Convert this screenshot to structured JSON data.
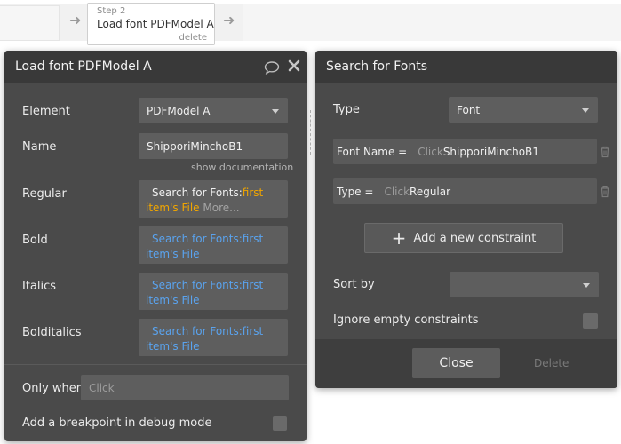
{
  "workflow": {
    "step_no": "Step 2",
    "step_title": "Load font PDFModel A",
    "step_delete": "delete"
  },
  "left_panel": {
    "title": "Load font PDFModel A",
    "element_label": "Element",
    "element_value": "PDFModel A",
    "name_label": "Name",
    "name_value": "ShipporiMinchoB1",
    "show_documentation": "show documentation",
    "regular_label": "Regular",
    "regular_expr_source": "Search for Fonts:",
    "regular_expr_op1": "first",
    "regular_expr_op2": "item's File",
    "regular_expr_more": "More...",
    "bold_label": "Bold",
    "bold_expr_line1": "Search for Fonts:first",
    "bold_expr_line2": "item's File",
    "italics_label": "Italics",
    "italics_expr_line1": "Search for Fonts:first",
    "italics_expr_line2": "item's File",
    "bolditalics_label": "Bolditalics",
    "bolditalics_expr_line1": "Search for Fonts:first",
    "bolditalics_expr_line2": "item's File",
    "only_when_label": "Only when",
    "only_when_placeholder": "Click",
    "breakpoint_label": "Add a breakpoint in debug mode"
  },
  "right_panel": {
    "title": "Search for Fonts",
    "type_label": "Type",
    "type_value": "Font",
    "constraints": [
      {
        "label": "Font Name =",
        "click": "Click",
        "value": "ShipporiMinchoB1"
      },
      {
        "label": "Type =",
        "click": "Click",
        "value": "Regular"
      }
    ],
    "add_constraint": "Add a new constraint",
    "sort_by_label": "Sort by",
    "sort_by_value": "",
    "ignore_empty_label": "Ignore empty constraints",
    "close_button": "Close",
    "delete_button": "Delete"
  },
  "colors": {
    "panel_bg": "#4a4a4a",
    "header_bg": "#393939",
    "expression_blue": "#5aa3ee",
    "expression_orange": "#f0a500"
  },
  "icons": [
    "comment-icon",
    "close-icon",
    "trash-icon",
    "plus-icon",
    "chevron-down-icon",
    "arrow-right-icon"
  ]
}
